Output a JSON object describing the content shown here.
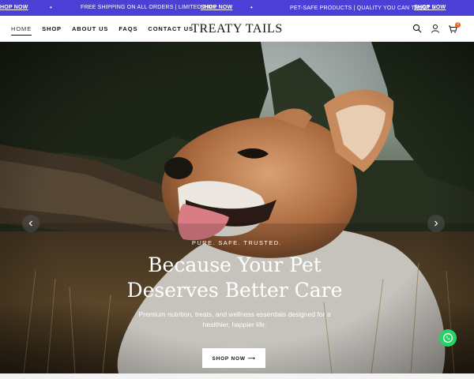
{
  "announcement": {
    "left_link": "HOP NOW",
    "shipping_text": "FREE SHIPPING ON ALL ORDERS | LIMITED TIME",
    "shipping_link": "SHOP NOW",
    "quality_text": "PET-SAFE PRODUCTS | QUALITY YOU CAN TRUST ✓",
    "quality_link": "SHOP NOW",
    "separator": "•",
    "background_color": "#4b3fd6"
  },
  "header": {
    "nav": [
      "HOME",
      "SHOP",
      "ABOUT US",
      "FAQS",
      "CONTACT US"
    ],
    "active_nav": "HOME",
    "logo": "TREATY TAILS",
    "icons": [
      "search-icon",
      "account-icon",
      "cart-icon"
    ],
    "cart_count": "0",
    "cart_badge_color": "#e8611a"
  },
  "hero": {
    "eyebrow": "PURE. SAFE. TRUSTED.",
    "headline_line1": "Because Your Pet",
    "headline_line2": "Deserves Better Care",
    "subtext": "Premium nutrition, treats, and wellness essentials designed for a healthier, happier life.",
    "cta": "SHOP NOW ⟶",
    "prev_icon": "chevron-left-icon",
    "next_icon": "chevron-right-icon"
  },
  "floating": {
    "chat_icon": "whatsapp-icon",
    "chat_color": "#25d366"
  }
}
